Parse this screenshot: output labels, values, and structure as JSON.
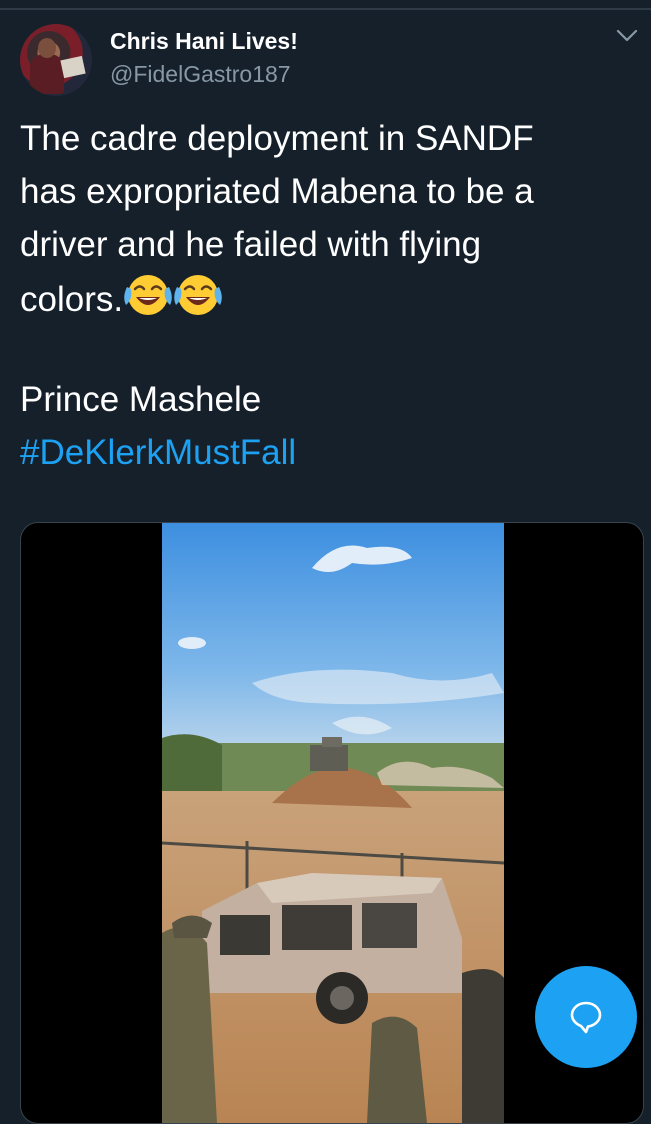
{
  "tweet": {
    "author": {
      "display_name": "Chris Hani Lives!",
      "handle": "@FidelGastro187",
      "avatar_icon": "avatar-photo"
    },
    "menu_icon": "chevron-down-icon",
    "text_lines": [
      "The cadre deployment in SANDF",
      "has expropriated Mabena to be a",
      "driver and he failed with flying",
      "colors."
    ],
    "emoji": [
      "face-with-tears-of-joy",
      "face-with-tears-of-joy"
    ],
    "signature": "Prince Mashele",
    "hashtag": "#DeKlerkMustFall",
    "media": {
      "type": "video",
      "description_icon": "video-thumbnail"
    }
  },
  "compose_button": {
    "icon": "compose-bubble-icon",
    "color": "#1da1f2"
  },
  "colors": {
    "background": "#15202b",
    "text": "#ffffff",
    "secondary_text": "#8899a6",
    "link": "#1da1f2"
  }
}
